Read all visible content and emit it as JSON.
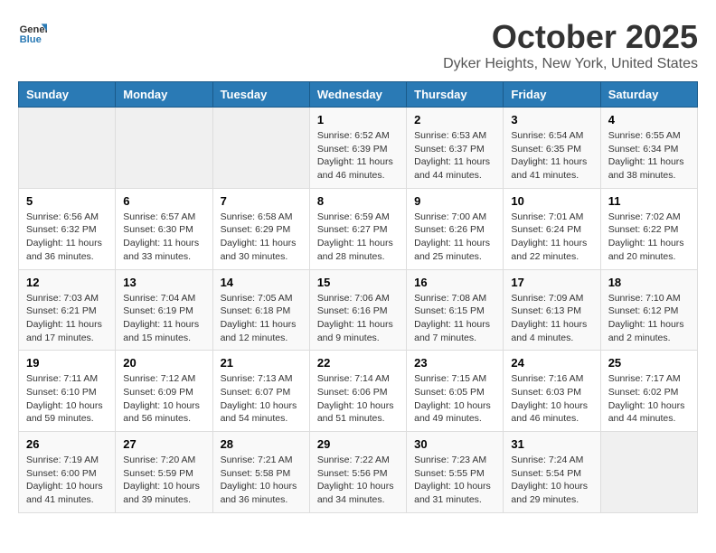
{
  "logo": {
    "line1": "General",
    "line2": "Blue"
  },
  "title": "October 2025",
  "location": "Dyker Heights, New York, United States",
  "days_of_week": [
    "Sunday",
    "Monday",
    "Tuesday",
    "Wednesday",
    "Thursday",
    "Friday",
    "Saturday"
  ],
  "weeks": [
    [
      {
        "day": "",
        "content": ""
      },
      {
        "day": "",
        "content": ""
      },
      {
        "day": "",
        "content": ""
      },
      {
        "day": "1",
        "content": "Sunrise: 6:52 AM\nSunset: 6:39 PM\nDaylight: 11 hours and 46 minutes."
      },
      {
        "day": "2",
        "content": "Sunrise: 6:53 AM\nSunset: 6:37 PM\nDaylight: 11 hours and 44 minutes."
      },
      {
        "day": "3",
        "content": "Sunrise: 6:54 AM\nSunset: 6:35 PM\nDaylight: 11 hours and 41 minutes."
      },
      {
        "day": "4",
        "content": "Sunrise: 6:55 AM\nSunset: 6:34 PM\nDaylight: 11 hours and 38 minutes."
      }
    ],
    [
      {
        "day": "5",
        "content": "Sunrise: 6:56 AM\nSunset: 6:32 PM\nDaylight: 11 hours and 36 minutes."
      },
      {
        "day": "6",
        "content": "Sunrise: 6:57 AM\nSunset: 6:30 PM\nDaylight: 11 hours and 33 minutes."
      },
      {
        "day": "7",
        "content": "Sunrise: 6:58 AM\nSunset: 6:29 PM\nDaylight: 11 hours and 30 minutes."
      },
      {
        "day": "8",
        "content": "Sunrise: 6:59 AM\nSunset: 6:27 PM\nDaylight: 11 hours and 28 minutes."
      },
      {
        "day": "9",
        "content": "Sunrise: 7:00 AM\nSunset: 6:26 PM\nDaylight: 11 hours and 25 minutes."
      },
      {
        "day": "10",
        "content": "Sunrise: 7:01 AM\nSunset: 6:24 PM\nDaylight: 11 hours and 22 minutes."
      },
      {
        "day": "11",
        "content": "Sunrise: 7:02 AM\nSunset: 6:22 PM\nDaylight: 11 hours and 20 minutes."
      }
    ],
    [
      {
        "day": "12",
        "content": "Sunrise: 7:03 AM\nSunset: 6:21 PM\nDaylight: 11 hours and 17 minutes."
      },
      {
        "day": "13",
        "content": "Sunrise: 7:04 AM\nSunset: 6:19 PM\nDaylight: 11 hours and 15 minutes."
      },
      {
        "day": "14",
        "content": "Sunrise: 7:05 AM\nSunset: 6:18 PM\nDaylight: 11 hours and 12 minutes."
      },
      {
        "day": "15",
        "content": "Sunrise: 7:06 AM\nSunset: 6:16 PM\nDaylight: 11 hours and 9 minutes."
      },
      {
        "day": "16",
        "content": "Sunrise: 7:08 AM\nSunset: 6:15 PM\nDaylight: 11 hours and 7 minutes."
      },
      {
        "day": "17",
        "content": "Sunrise: 7:09 AM\nSunset: 6:13 PM\nDaylight: 11 hours and 4 minutes."
      },
      {
        "day": "18",
        "content": "Sunrise: 7:10 AM\nSunset: 6:12 PM\nDaylight: 11 hours and 2 minutes."
      }
    ],
    [
      {
        "day": "19",
        "content": "Sunrise: 7:11 AM\nSunset: 6:10 PM\nDaylight: 10 hours and 59 minutes."
      },
      {
        "day": "20",
        "content": "Sunrise: 7:12 AM\nSunset: 6:09 PM\nDaylight: 10 hours and 56 minutes."
      },
      {
        "day": "21",
        "content": "Sunrise: 7:13 AM\nSunset: 6:07 PM\nDaylight: 10 hours and 54 minutes."
      },
      {
        "day": "22",
        "content": "Sunrise: 7:14 AM\nSunset: 6:06 PM\nDaylight: 10 hours and 51 minutes."
      },
      {
        "day": "23",
        "content": "Sunrise: 7:15 AM\nSunset: 6:05 PM\nDaylight: 10 hours and 49 minutes."
      },
      {
        "day": "24",
        "content": "Sunrise: 7:16 AM\nSunset: 6:03 PM\nDaylight: 10 hours and 46 minutes."
      },
      {
        "day": "25",
        "content": "Sunrise: 7:17 AM\nSunset: 6:02 PM\nDaylight: 10 hours and 44 minutes."
      }
    ],
    [
      {
        "day": "26",
        "content": "Sunrise: 7:19 AM\nSunset: 6:00 PM\nDaylight: 10 hours and 41 minutes."
      },
      {
        "day": "27",
        "content": "Sunrise: 7:20 AM\nSunset: 5:59 PM\nDaylight: 10 hours and 39 minutes."
      },
      {
        "day": "28",
        "content": "Sunrise: 7:21 AM\nSunset: 5:58 PM\nDaylight: 10 hours and 36 minutes."
      },
      {
        "day": "29",
        "content": "Sunrise: 7:22 AM\nSunset: 5:56 PM\nDaylight: 10 hours and 34 minutes."
      },
      {
        "day": "30",
        "content": "Sunrise: 7:23 AM\nSunset: 5:55 PM\nDaylight: 10 hours and 31 minutes."
      },
      {
        "day": "31",
        "content": "Sunrise: 7:24 AM\nSunset: 5:54 PM\nDaylight: 10 hours and 29 minutes."
      },
      {
        "day": "",
        "content": ""
      }
    ]
  ]
}
